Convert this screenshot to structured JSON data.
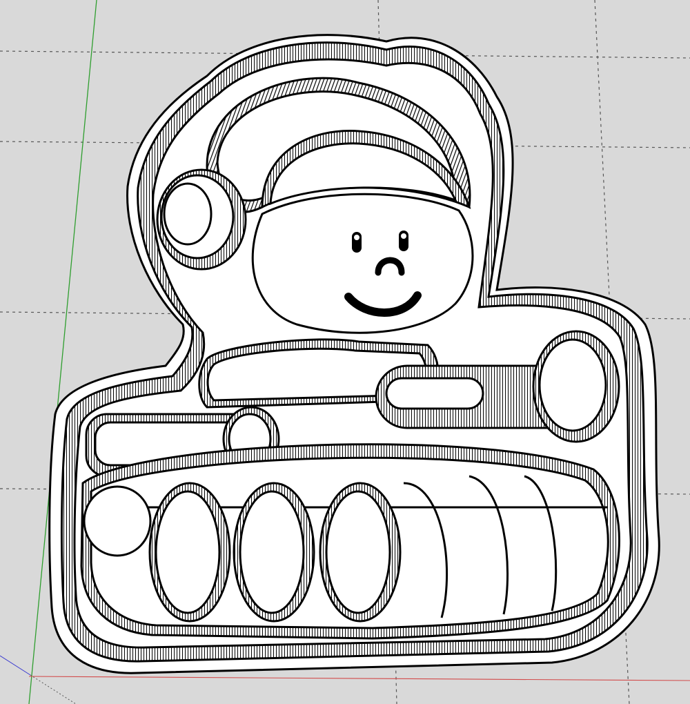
{
  "viewport": {
    "background_color": "#d9d9d9",
    "model": "cookie-cutter-tank-character",
    "grid": true,
    "axes": {
      "green_axis_color": "#2e9e2e",
      "red_axis_color": "#d24a4a",
      "blue_axis_color": "#3a3ad0"
    },
    "outline_color": "#000000",
    "face_color": "#ffffff"
  }
}
